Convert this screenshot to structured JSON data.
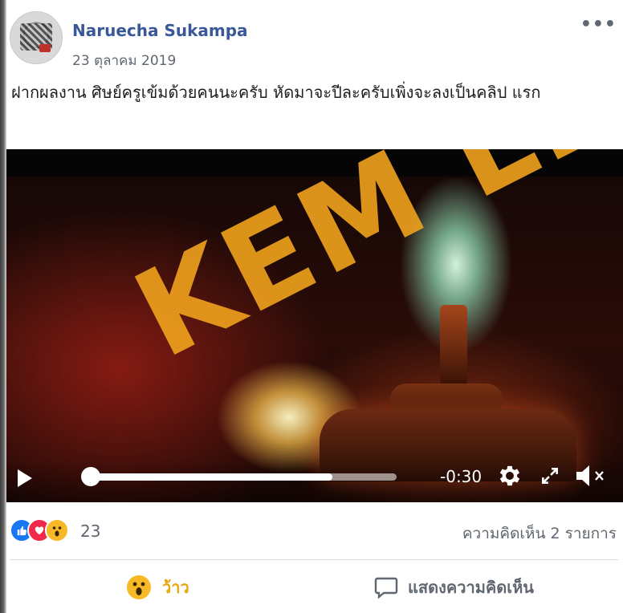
{
  "post": {
    "author": "Naruecha Sukampa",
    "date": "23 ตุลาคม 2019",
    "more_label": "•••",
    "text": "ฝากผลงาน ศิษย์ครูเข้มด้วยคนนะครับ หัดมาจะปีละครับเพิ่งจะลงเป็นคลิป แรก"
  },
  "video": {
    "watermark": "KEM LIFE",
    "time_remaining": "-0:30",
    "progress": 0.79
  },
  "reactions": {
    "count": "23",
    "comments": "ความคิดเห็น 2 รายการ",
    "icons": [
      "like-icon",
      "love-icon",
      "wow-icon"
    ]
  },
  "actions": {
    "wow_label": "ว้าว",
    "comment_label": "แสดงความคิดเห็น"
  },
  "colors": {
    "author_link": "#385898",
    "watermark": "#f0a21d",
    "wow": "#e8a50e"
  }
}
